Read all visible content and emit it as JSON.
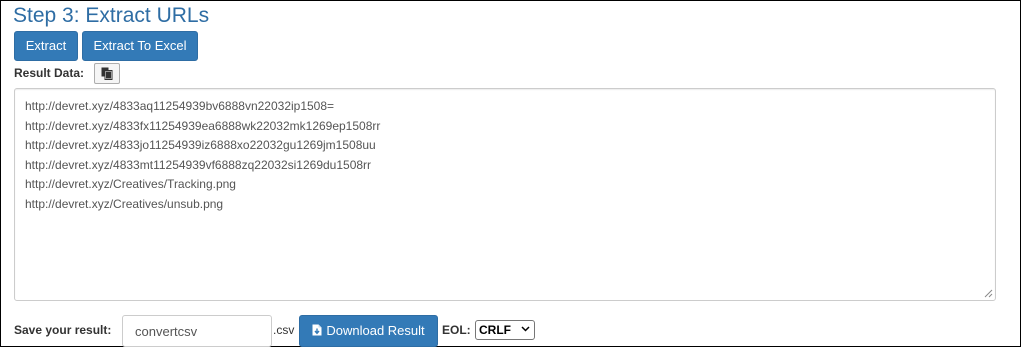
{
  "header": {
    "title": "Step 3: Extract URLs"
  },
  "toolbar": {
    "extract_label": "Extract",
    "extract_excel_label": "Extract To Excel"
  },
  "result": {
    "label": "Result Data:",
    "copy_icon": "copy-icon",
    "lines": [
      "http://devret.xyz/4833aq11254939bv6888vn22032ip1508=",
      "http://devret.xyz/4833fx11254939ea6888wk22032mk1269ep1508rr",
      "http://devret.xyz/4833jo11254939iz6888xo22032gu1269jm1508uu",
      "http://devret.xyz/4833mt11254939vf6888zq22032si1269du1508rr",
      "http://devret.xyz/Creatives/Tracking.png",
      "http://devret.xyz/Creatives/unsub.png"
    ]
  },
  "save": {
    "label": "Save your result:",
    "filename_value": "convertcsv",
    "extension": ".csv",
    "download_label": "Download Result",
    "download_icon": "download-file-icon"
  },
  "eol": {
    "label": "EOL:",
    "selected": "CRLF"
  },
  "colors": {
    "accent": "#337ab7",
    "title": "#2e6da4"
  }
}
